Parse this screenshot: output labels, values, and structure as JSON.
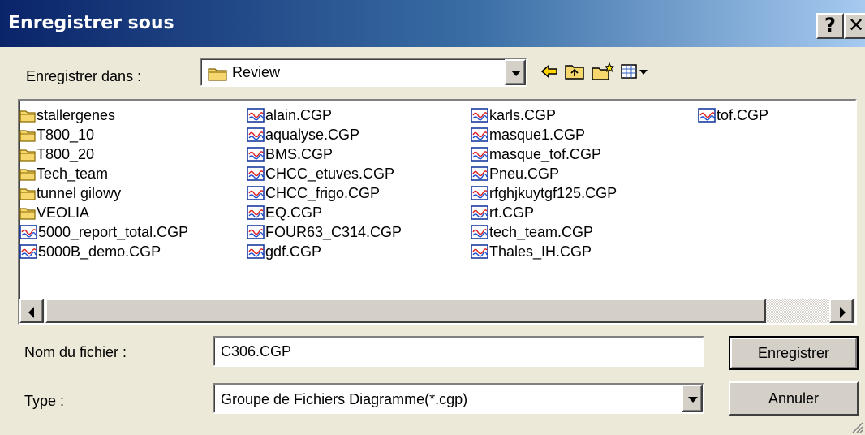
{
  "window": {
    "title": "Enregistrer sous",
    "help_glyph": "?",
    "close_glyph": "✕"
  },
  "save_in": {
    "label": "Enregistrer dans :",
    "value": "Review"
  },
  "toolbar_icons": [
    "back-arrow-icon",
    "up-folder-icon",
    "new-folder-icon",
    "view-menu-icon"
  ],
  "files": {
    "col1": [
      {
        "name": "stallergenes",
        "type": "folder"
      },
      {
        "name": "T800_10",
        "type": "folder"
      },
      {
        "name": "T800_20",
        "type": "folder"
      },
      {
        "name": "Tech_team",
        "type": "folder"
      },
      {
        "name": "tunnel gilowy",
        "type": "folder"
      },
      {
        "name": "VEOLIA",
        "type": "folder"
      },
      {
        "name": "5000_report_total.CGP",
        "type": "file"
      },
      {
        "name": "5000B_demo.CGP",
        "type": "file"
      }
    ],
    "col2": [
      {
        "name": "alain.CGP",
        "type": "file"
      },
      {
        "name": "aqualyse.CGP",
        "type": "file"
      },
      {
        "name": "BMS.CGP",
        "type": "file"
      },
      {
        "name": "CHCC_etuves.CGP",
        "type": "file"
      },
      {
        "name": "CHCC_frigo.CGP",
        "type": "file"
      },
      {
        "name": "EQ.CGP",
        "type": "file"
      },
      {
        "name": "FOUR63_C314.CGP",
        "type": "file"
      },
      {
        "name": "gdf.CGP",
        "type": "file"
      }
    ],
    "col3": [
      {
        "name": "karls.CGP",
        "type": "file"
      },
      {
        "name": "masque1.CGP",
        "type": "file"
      },
      {
        "name": "masque_tof.CGP",
        "type": "file"
      },
      {
        "name": "Pneu.CGP",
        "type": "file"
      },
      {
        "name": "rfghjkuytgf125.CGP",
        "type": "file"
      },
      {
        "name": "rt.CGP",
        "type": "file"
      },
      {
        "name": "tech_team.CGP",
        "type": "file"
      },
      {
        "name": "Thales_IH.CGP",
        "type": "file"
      }
    ],
    "col4": [
      {
        "name": "tof.CGP",
        "type": "file"
      }
    ]
  },
  "scrollbar": {
    "thumb_fraction": 0.89,
    "position": 0
  },
  "filename": {
    "label": "Nom du fichier :",
    "value": "C306.CGP"
  },
  "filetype": {
    "label": "Type :",
    "value": "Groupe de Fichiers Diagramme(*.cgp)"
  },
  "buttons": {
    "save": "Enregistrer",
    "cancel": "Annuler"
  },
  "colors": {
    "title_start": "#0a246a",
    "title_end": "#a6caf0",
    "face": "#ece9d8",
    "folder": "#f5d76e"
  }
}
